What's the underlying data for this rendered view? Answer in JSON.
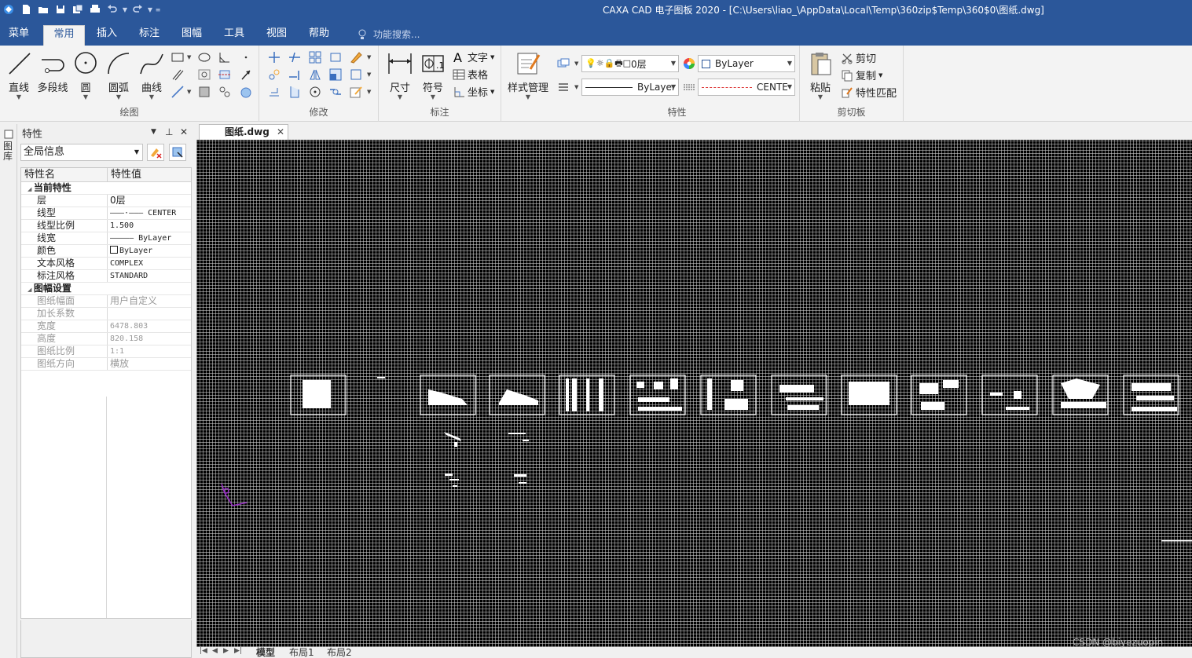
{
  "window": {
    "title": "CAXA CAD 电子图板 2020 - [C:\\Users\\liao_\\AppData\\Local\\Temp\\360zip$Temp\\360$0\\图纸.dwg]"
  },
  "quick_access": {
    "icons": [
      "app-icon",
      "new-icon",
      "open-icon",
      "save-icon",
      "save-as-icon",
      "print-icon",
      "undo-icon",
      "redo-icon",
      "customize-icon"
    ]
  },
  "ribbon_tabs": [
    "菜单",
    "常用",
    "插入",
    "标注",
    "图幅",
    "工具",
    "视图",
    "帮助"
  ],
  "active_tab": "常用",
  "search_placeholder": "功能搜索...",
  "groups": {
    "draw": {
      "label": "绘图",
      "buttons": [
        "直线",
        "多段线",
        "圆",
        "圆弧",
        "曲线"
      ]
    },
    "modify": {
      "label": "修改"
    },
    "annotate": {
      "label": "标注",
      "buttons": [
        "尺寸",
        "符号"
      ],
      "small": [
        "文字",
        "表格",
        "坐标"
      ]
    },
    "style": {
      "button": "样式管理"
    },
    "properties": {
      "label": "特性",
      "layer": "0层",
      "color": "ByLayer",
      "linewidth": "ByLayer",
      "linetype": "CENTE"
    },
    "clipboard": {
      "label": "剪切板",
      "paste": "粘贴",
      "cut": "剪切",
      "copy": "复制",
      "match": "特性匹配"
    }
  },
  "left_strip": {
    "label": "图库"
  },
  "properties_panel": {
    "title": "特性",
    "selector": "全局信息",
    "col_name": "特性名",
    "col_value": "特性值",
    "current_section": "当前特性",
    "current": [
      {
        "name": "层",
        "value": "0层"
      },
      {
        "name": "线型",
        "value": "———·——— CENTER"
      },
      {
        "name": "线型比例",
        "value": "1.500"
      },
      {
        "name": "线宽",
        "value": "————— ByLayer"
      },
      {
        "name": "颜色",
        "value": "ByLayer"
      },
      {
        "name": "文本风格",
        "value": "COMPLEX"
      },
      {
        "name": "标注风格",
        "value": "STANDARD"
      }
    ],
    "sheet_section": "图幅设置",
    "sheet": [
      {
        "name": "图纸幅面",
        "value": "用户自定义"
      },
      {
        "name": "加长系数",
        "value": ""
      },
      {
        "name": "宽度",
        "value": "6478.803"
      },
      {
        "name": "高度",
        "value": "820.158"
      },
      {
        "name": "图纸比例",
        "value": "1:1"
      },
      {
        "name": "图纸方向",
        "value": "横放"
      }
    ]
  },
  "document_tab": "图纸.dwg",
  "layout_tabs": [
    "模型",
    "布局1",
    "布局2"
  ],
  "active_layout": "模型",
  "watermark": "CSDN @biyezuopin",
  "colors": {
    "titlebar": "#2b579a",
    "canvas": "#000000",
    "axis": "#9b30c8"
  }
}
